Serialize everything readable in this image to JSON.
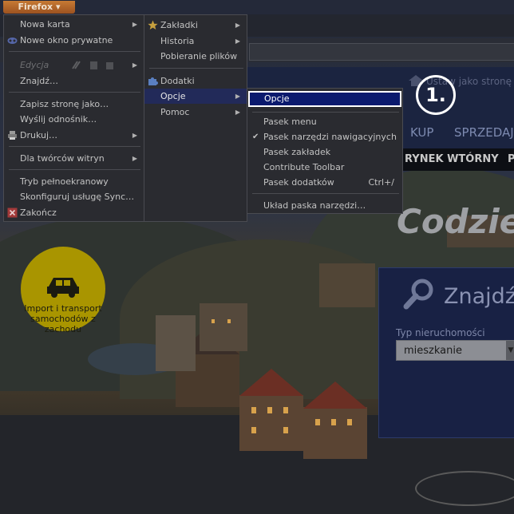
{
  "firefox_button": "Firefox",
  "main_menu": {
    "new_tab": "Nowa karta",
    "new_private": "Nowe okno prywatne",
    "edit": "Edycja",
    "find": "Znajdź…",
    "save_page": "Zapisz stronę jako…",
    "send_link": "Wyślij odnośnik…",
    "print": "Drukuj…",
    "devtools": "Dla twórców witryn",
    "fullscreen": "Tryb pełnoekranowy",
    "sync": "Skonfiguruj usługę Sync…",
    "quit": "Zakończ"
  },
  "sub_menu": {
    "bookmarks": "Zakładki",
    "history": "Historia",
    "downloads": "Pobieranie plików",
    "addons": "Dodatki",
    "options": "Opcje",
    "help": "Pomoc"
  },
  "options_menu": {
    "options": "Opcje",
    "menu_bar": "Pasek menu",
    "nav_toolbar": "Pasek narzędzi nawigacyjnych",
    "bookmarks_bar": "Pasek zakładek",
    "contribute": "Contribute Toolbar",
    "addon_bar": "Pasek dodatków",
    "addon_bar_shortcut": "Ctrl+/",
    "toolbar_layout": "Układ paska narzędzi…"
  },
  "page": {
    "set_home": "Ustaw jako stronę",
    "step": "1.",
    "nav_kup": "KUP",
    "nav_sprzedaj": "SPRZEDAJ",
    "nav_rynek": "RYNEK WTÓRNY",
    "nav_p": "P",
    "headline": "Codzie",
    "search_title": "Znajdź",
    "property_label": "Typ nieruchomości",
    "property_value": "mieszkanie",
    "transport_badge": "Import i transport samochodów z zachodu"
  },
  "colors": {
    "highlight": "#0b1a6e",
    "badge": "#a99500",
    "firefox": "#c77a34"
  },
  "icons": [
    "star-icon",
    "puzzle-icon",
    "printer-icon",
    "close-square-icon",
    "home-icon",
    "magnifier-icon",
    "car-icon",
    "check-icon",
    "chevron-right-icon"
  ]
}
